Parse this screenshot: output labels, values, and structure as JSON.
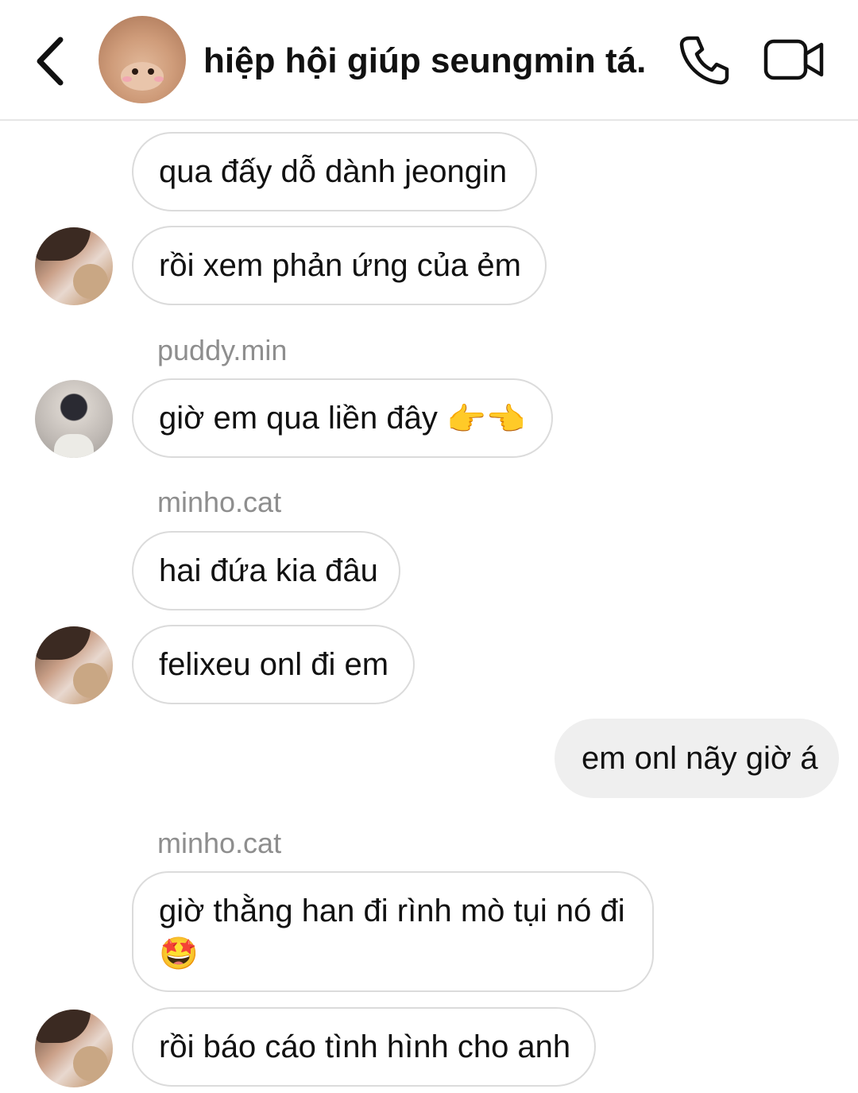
{
  "header": {
    "title": "hiệp hội giúp seungmin tá..",
    "back_icon": "chevron-left-icon",
    "call_icon": "phone-icon",
    "video_icon": "video-camera-icon"
  },
  "messages": [
    {
      "text": "qua đấy dỗ dành jeongin"
    },
    {
      "text": "rồi xem phản ứng của ẻm"
    },
    {
      "sender": "puddy.min",
      "text": "giờ em qua liền đây",
      "emoji": "👉👈"
    },
    {
      "sender": "minho.cat",
      "text": "hai đứa kia đâu"
    },
    {
      "text": "felixeu onl đi em"
    },
    {
      "text": "em onl nãy giờ á"
    },
    {
      "sender": "minho.cat",
      "text": "giờ thằng han đi rình mò tụi nó đi",
      "emoji": "🤩"
    },
    {
      "text": "rồi báo cáo tình hình cho anh"
    }
  ],
  "colors": {
    "received_border": "#dbdbdb",
    "sent_bg": "#efefef",
    "sender_name": "#8e8e8e"
  }
}
